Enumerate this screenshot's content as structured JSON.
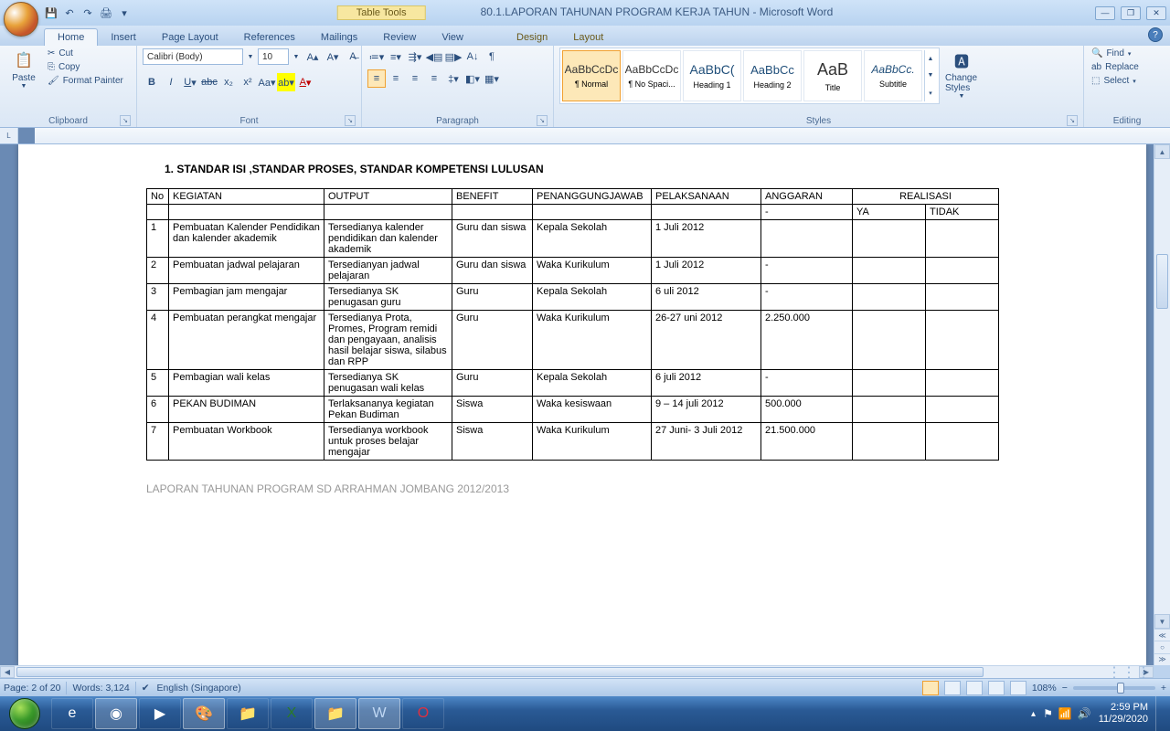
{
  "title": {
    "table_tools": "Table Tools",
    "document": "80.1.LAPORAN TAHUNAN PROGRAM KERJA TAHUN - Microsoft Word"
  },
  "tabs": {
    "home": "Home",
    "insert": "Insert",
    "page_layout": "Page Layout",
    "references": "References",
    "mailings": "Mailings",
    "review": "Review",
    "view": "View",
    "design": "Design",
    "layout": "Layout"
  },
  "ribbon": {
    "clipboard": {
      "label": "Clipboard",
      "paste": "Paste",
      "cut": "Cut",
      "copy": "Copy",
      "format_painter": "Format Painter"
    },
    "font": {
      "label": "Font",
      "name": "Calibri (Body)",
      "size": "10"
    },
    "paragraph": {
      "label": "Paragraph"
    },
    "styles": {
      "label": "Styles",
      "items": [
        {
          "preview": "AaBbCcDc",
          "name": "¶ Normal"
        },
        {
          "preview": "AaBbCcDc",
          "name": "¶ No Spaci..."
        },
        {
          "preview": "AaBbC(",
          "name": "Heading 1"
        },
        {
          "preview": "AaBbCc",
          "name": "Heading 2"
        },
        {
          "preview": "AaB",
          "name": "Title"
        },
        {
          "preview": "AaBbCc.",
          "name": "Subtitle"
        }
      ],
      "change": "Change Styles"
    },
    "editing": {
      "label": "Editing",
      "find": "Find",
      "replace": "Replace",
      "select": "Select"
    }
  },
  "doc": {
    "heading": "1.     STANDAR ISI ,STANDAR PROSES, STANDAR KOMPETENSI LULUSAN",
    "footer": "LAPORAN TAHUNAN PROGRAM SD ARRAHMAN JOMBANG 2012/2013",
    "columns": {
      "no": "No",
      "kegiatan": "KEGIATAN",
      "output": "OUTPUT",
      "benefit": "BENEFIT",
      "pj": "PENANGGUNGJAWAB",
      "pelaksanaan": "PELAKSANAAN",
      "anggaran": "ANGGARAN",
      "realisasi": "REALISASI",
      "ya": "YA",
      "tidak": "TIDAK"
    },
    "rows": [
      {
        "no": "1",
        "kegiatan": "Pembuatan Kalender Pendidikan dan kalender akademik",
        "output": "Tersedianya kalender pendidikan dan kalender akademik",
        "benefit": "Guru dan siswa",
        "pj": "Kepala Sekolah",
        "pel": "1 Juli 2012",
        "ang": ""
      },
      {
        "no": "2",
        "kegiatan": "Pembuatan jadwal pelajaran",
        "output": "Tersedianyan jadwal pelajaran",
        "benefit": "Guru dan siswa",
        "pj": "Waka Kurikulum",
        "pel": "1 Juli 2012",
        "ang": "-"
      },
      {
        "no": "3",
        "kegiatan": "Pembagian jam mengajar",
        "output": "Tersedianya SK penugasan guru",
        "benefit": "Guru",
        "pj": "Kepala Sekolah",
        "pel": "6 uli 2012",
        "ang": "-"
      },
      {
        "no": "4",
        "kegiatan": "Pembuatan perangkat mengajar",
        "output": "Tersedianya Prota, Promes, Program remidi dan pengayaan, analisis hasil belajar siswa, silabus dan RPP",
        "benefit": "Guru",
        "pj": "Waka Kurikulum",
        "pel": "26-27 uni 2012",
        "ang": "2.250.000"
      },
      {
        "no": "5",
        "kegiatan": "Pembagian wali kelas",
        "output": "Tersedianya SK penugasan wali kelas",
        "benefit": "Guru",
        "pj": "Kepala Sekolah",
        "pel": "6 juli 2012",
        "ang": "-"
      },
      {
        "no": "6",
        "kegiatan": "PEKAN BUDIMAN",
        "output": "Terlaksananya kegiatan Pekan Budiman",
        "benefit": "Siswa",
        "pj": "Waka kesiswaan",
        "pel": "9 – 14 juli 2012",
        "ang": "500.000"
      },
      {
        "no": "7",
        "kegiatan": "Pembuatan Workbook",
        "output": "Tersedianya workbook untuk proses belajar mengajar",
        "benefit": "Siswa",
        "pj": "Waka Kurikulum",
        "pel": "27 Juni- 3 Juli 2012",
        "ang": "21.500.000"
      }
    ]
  },
  "status": {
    "page": "Page: 2 of 20",
    "words": "Words: 3,124",
    "lang": "English (Singapore)",
    "zoom": "108%"
  },
  "tray": {
    "time": "2:59 PM",
    "date": "11/29/2020"
  }
}
